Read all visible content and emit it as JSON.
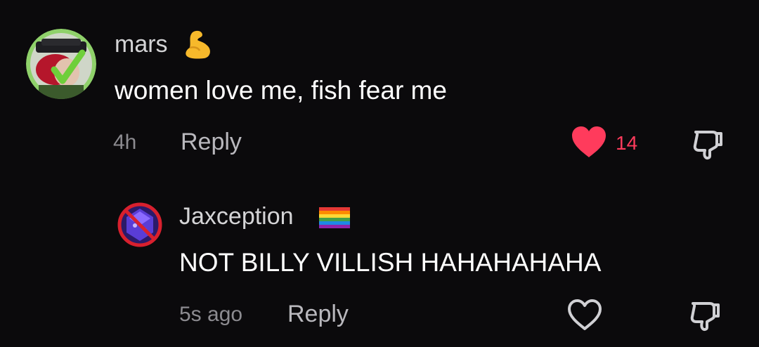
{
  "comments": [
    {
      "username": "mars",
      "username_emoji": "flexed-biceps",
      "text": "women love me, fish fear me",
      "time": "4h",
      "reply_label": "Reply",
      "liked": true,
      "like_count": "14"
    },
    {
      "username": "Jaxception",
      "username_emoji": "rainbow-flag",
      "text": "NOT BILLY VILLISH HAHAHAHAHA",
      "time": "5s ago",
      "reply_label": "Reply",
      "liked": false,
      "like_count": ""
    }
  ],
  "colors": {
    "background": "#0b0a0c",
    "like_active": "#ff3b5c",
    "secondary_text": "#8c8b90"
  }
}
